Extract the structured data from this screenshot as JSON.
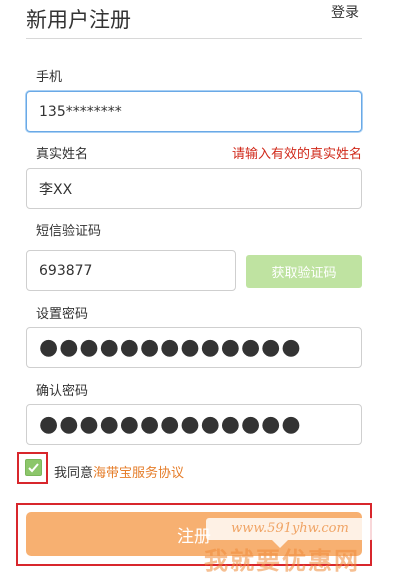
{
  "header": {
    "title": "新用户注册",
    "login_link": "登录"
  },
  "phone": {
    "label": "手机",
    "value": "135********"
  },
  "name": {
    "label": "真实姓名",
    "error": "请输入有效的真实姓名",
    "value": "李XX"
  },
  "sms": {
    "label": "短信验证码",
    "value": "693877",
    "send_button": "获取验证码"
  },
  "password": {
    "label": "设置密码",
    "value": "●●●●●●●●●●●●●"
  },
  "confirm": {
    "label": "确认密码",
    "value": "●●●●●●●●●●●●●"
  },
  "agreement": {
    "checked": true,
    "text": "我同意",
    "link": "海带宝服务协议"
  },
  "register": {
    "label": "注册"
  },
  "watermark": {
    "url": "www.591yhw.com",
    "name": "我就要优惠网"
  },
  "colors": {
    "accent_green": "#8cc66a",
    "button_orange": "#f7b071",
    "error_red": "#d0291a",
    "highlight_red": "#d8262c"
  }
}
